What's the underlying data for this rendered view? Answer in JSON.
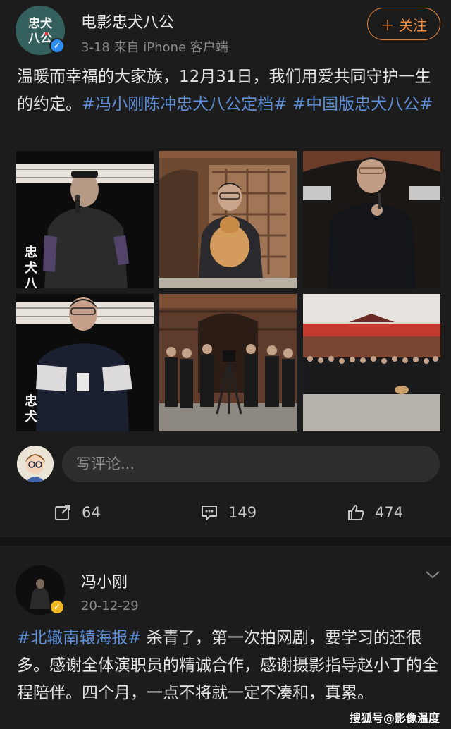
{
  "post1": {
    "account_name": "电影忠犬八公",
    "avatar_text": "忠犬八公",
    "meta": "3-18  来自 iPhone 客户端",
    "follow_label": "关注",
    "text_plain": "温暖而幸福的大家族，12月31日，我们用爱共同守护一生的约定。",
    "hashtags": [
      "#冯小刚陈冲忠犬八公定档#",
      "#中国版忠犬八公#"
    ],
    "photos": [
      {
        "icon": "person-with-microphone-photo"
      },
      {
        "icon": "person-holding-dog-photo"
      },
      {
        "icon": "person-speaking-photo"
      },
      {
        "icon": "person-with-glasses-photo"
      },
      {
        "icon": "crew-with-camera-photo"
      },
      {
        "icon": "group-photo"
      }
    ],
    "comment_placeholder": "写评论...",
    "actions": {
      "repost_count": "64",
      "comment_count": "149",
      "like_count": "474"
    }
  },
  "post2": {
    "account_name": "冯小刚",
    "meta": "20-12-29",
    "hashtag": "#北辙南辕海报#",
    "text_plain": " 杀青了，第一次拍网剧，要学习的还很多。感谢全体演职员的精诚合作，感谢摄影指导赵小丁的全程陪伴。四个月，一点不将就一定不凑和，真累。"
  },
  "watermark": "搜狐号@影像温度",
  "colors": {
    "background": "#1c1c1c",
    "link": "#5f8fd8",
    "follow": "#f08a3c",
    "verified_blue": "#2d8cf0",
    "verified_gold": "#f2b824"
  }
}
